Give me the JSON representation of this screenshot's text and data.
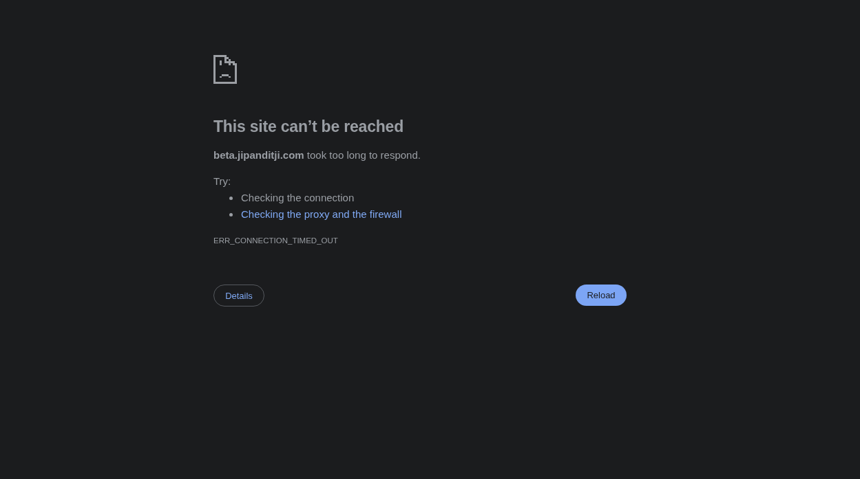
{
  "heading": "This site can’t be reached",
  "summary": "**beta.jipanditji.com** took too long to respond.",
  "suggestions": {
    "label": "Try:",
    "items": [
      {
        "kind": "text",
        "text": "Checking the connection"
      },
      {
        "kind": "link",
        "text": "Checking the proxy and the firewall"
      }
    ]
  },
  "error_code": "ERR_CONNECTION_TIMED_OUT",
  "buttons": [
    {
      "kind": "secondary",
      "label": "Details"
    },
    {
      "kind": "primary",
      "label": "Reload"
    }
  ]
}
